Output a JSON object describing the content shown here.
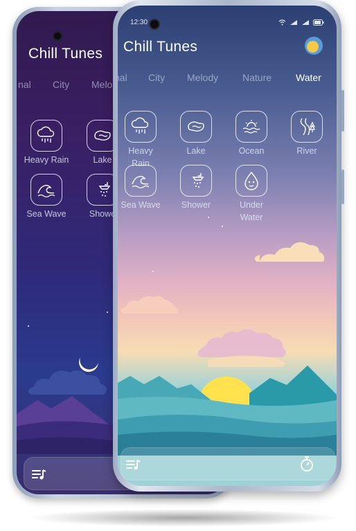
{
  "app": {
    "title": "Chill Tunes"
  },
  "status_bar": {
    "time": "12:30"
  },
  "front": {
    "categories": [
      "nal",
      "City",
      "Melody",
      "Nature",
      "Water"
    ],
    "active_category": "Water",
    "sounds": [
      {
        "label": "Heavy Rain",
        "icon": "rain-cloud-icon"
      },
      {
        "label": "Lake",
        "icon": "lake-icon"
      },
      {
        "label": "Ocean",
        "icon": "ocean-icon"
      },
      {
        "label": "River",
        "icon": "river-icon"
      },
      {
        "label": "Sea Wave",
        "icon": "sea-wave-icon"
      },
      {
        "label": "Shower",
        "icon": "shower-icon"
      },
      {
        "label": "Under Water",
        "icon": "underwater-icon"
      }
    ]
  },
  "back": {
    "categories": [
      "nal",
      "City",
      "Melo"
    ],
    "sounds": [
      {
        "label": "Heavy Rain",
        "icon": "rain-cloud-icon"
      },
      {
        "label": "Lake",
        "icon": "lake-icon"
      },
      {
        "label": "Sea Wave",
        "icon": "sea-wave-icon"
      },
      {
        "label": "Showe",
        "icon": "shower-icon"
      }
    ]
  },
  "controls": {
    "playlist_icon": "playlist-icon",
    "timer_icon": "stopwatch-icon"
  },
  "colors": {
    "accent_avatar": "#f7c948",
    "avatar_ring": "#5b9bd8"
  }
}
